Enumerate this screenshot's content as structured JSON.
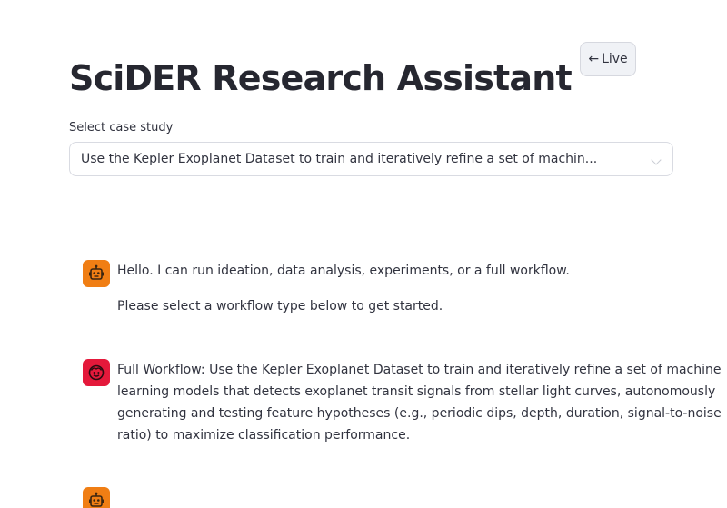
{
  "header": {
    "live_button": {
      "arrow": "←",
      "label": "Live"
    },
    "title": "SciDER Research Assistant"
  },
  "case_select": {
    "label": "Select case study",
    "value": "Use the Kepler Exoplanet Dataset to train and iteratively refine a set of machin..."
  },
  "chat": {
    "messages": [
      {
        "role": "assistant",
        "avatar_icon": "robot-icon",
        "paragraphs": [
          "Hello. I can run ideation, data analysis, experiments, or a full workflow.",
          "Please select a workflow type below to get started."
        ]
      },
      {
        "role": "user",
        "avatar_icon": "smiley-face-icon",
        "lines": [
          "Full Workflow: Use the Kepler Exoplanet Dataset to train and iteratively refine a set of machine",
          "learning models that detects exoplanet transit signals from stellar light curves, autonomously",
          "generating and testing feature hypotheses (e.g., periodic dips, depth, duration, signal-to-noise",
          "ratio) to maximize classification performance."
        ]
      },
      {
        "role": "assistant",
        "avatar_icon": "robot-icon"
      }
    ]
  },
  "colors": {
    "assistant_avatar": "#f07e14",
    "user_avatar": "#e4193b",
    "button_bg": "#f0f2f6",
    "text": "#31333f"
  }
}
